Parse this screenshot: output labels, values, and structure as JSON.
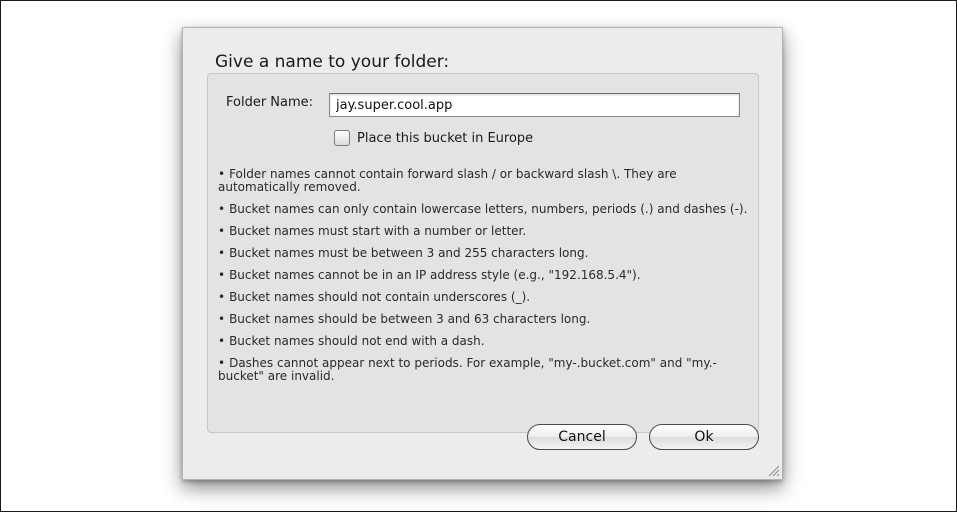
{
  "dialog": {
    "title": "Give a name to your folder:",
    "folder_name": {
      "label": "Folder Name:",
      "value": "jay.super.cool.app"
    },
    "europe_checkbox": {
      "label": "Place this bucket in Europe",
      "checked": false
    },
    "rules": [
      "Folder names cannot contain forward slash / or backward slash \\. They are automatically removed.",
      "Bucket names can only contain lowercase letters, numbers, periods (.) and dashes (-).",
      "Bucket names must start with a number or letter.",
      "Bucket names must be between 3 and 255 characters long.",
      "Bucket names cannot be in an IP address style (e.g., \"192.168.5.4\").",
      "Bucket names should not contain underscores (_).",
      "Bucket names should be between 3 and 63 characters long.",
      "Bucket names should not end with a dash.",
      "Dashes cannot appear next to periods. For example, \"my-.bucket.com\" and \"my.-bucket\" are invalid."
    ],
    "buttons": {
      "cancel_label": "Cancel",
      "ok_label": "Ok"
    }
  },
  "icons": {
    "bullet": "•",
    "resize_grip": "resize-grip-icon"
  },
  "colors": {
    "dialog_background": "#ececec",
    "group_background": "#e3e3e3"
  }
}
